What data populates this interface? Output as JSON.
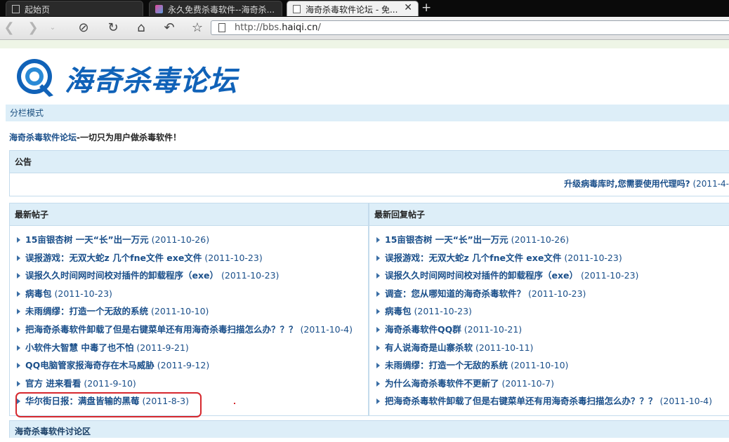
{
  "tabs": [
    {
      "label": "起始页"
    },
    {
      "label": "永久免费杀毒软件--海奇杀..."
    },
    {
      "label": "海奇杀毒软件论坛 - 免..."
    }
  ],
  "new_tab": "+",
  "address": {
    "prefix": "http://bbs.",
    "domain": "haiqi.cn",
    "suffix": "/"
  },
  "site": {
    "logo_text": "海奇杀毒论坛"
  },
  "mode_label": "分栏模式",
  "slogan": {
    "link": "海奇杀毒软件论坛",
    "rest": "-一切只为用户做杀毒软件！"
  },
  "notice": {
    "title": "公告",
    "item": "升级病毒库时,您需要使用代理吗?",
    "date": "(2011-4-"
  },
  "latest": {
    "title": "最新帖子",
    "items": [
      {
        "title": "15亩银杏树 一天“长”出一万元",
        "date": "(2011-10-26)"
      },
      {
        "title": "误报游戏：无双大蛇z 几个fne文件 exe文件",
        "date": "(2011-10-23)"
      },
      {
        "title": "误报久久时间网时间校对插件的卸载程序（exe）",
        "date": "(2011-10-23)"
      },
      {
        "title": "病毒包",
        "date": "(2011-10-23)"
      },
      {
        "title": "未雨绸缪：打造一个无敌的系统",
        "date": "(2011-10-10)"
      },
      {
        "title": "把海奇杀毒软件卸载了但是右键菜单还有用海奇杀毒扫描怎么办？？？",
        "date": "(2011-10-4)"
      },
      {
        "title": "小软件大智慧 中毒了也不怕",
        "date": "(2011-9-21)"
      },
      {
        "title": "QQ电脑管家报海奇存在木马威胁",
        "date": "(2011-9-12)"
      },
      {
        "title": "官方 进来看看",
        "date": "(2011-9-10)"
      },
      {
        "title": "华尔街日报：满盘皆输的黑莓",
        "date": "(2011-8-3)"
      }
    ]
  },
  "latest_reply": {
    "title": "最新回复帖子",
    "items": [
      {
        "title": "15亩银杏树 一天“长”出一万元",
        "date": "(2011-10-26)"
      },
      {
        "title": "误报游戏：无双大蛇z 几个fne文件 exe文件",
        "date": "(2011-10-23)"
      },
      {
        "title": "误报久久时间网时间校对插件的卸载程序（exe）",
        "date": "(2011-10-23)"
      },
      {
        "title": "调查：您从哪知道的海奇杀毒软件？",
        "date": "(2011-10-23)"
      },
      {
        "title": "病毒包",
        "date": "(2011-10-23)"
      },
      {
        "title": "海奇杀毒软件QQ群",
        "date": "(2011-10-21)"
      },
      {
        "title": "有人说海奇是山寨杀软",
        "date": "(2011-10-11)"
      },
      {
        "title": "未雨绸缪：打造一个无敌的系统",
        "date": "(2011-10-10)"
      },
      {
        "title": "为什么海奇杀毒软件不更新了",
        "date": "(2011-10-7)"
      },
      {
        "title": "把海奇杀毒软件卸载了但是右键菜单还有用海奇杀毒扫描怎么办？？？",
        "date": "(2011-10-4)"
      }
    ]
  },
  "forum_section": "海奇杀毒软件讨论区",
  "colors": {
    "link": "#1a4f8a",
    "header_bg": "#ddeef8",
    "highlight": "#d6282e",
    "logo": "#1062b8"
  }
}
